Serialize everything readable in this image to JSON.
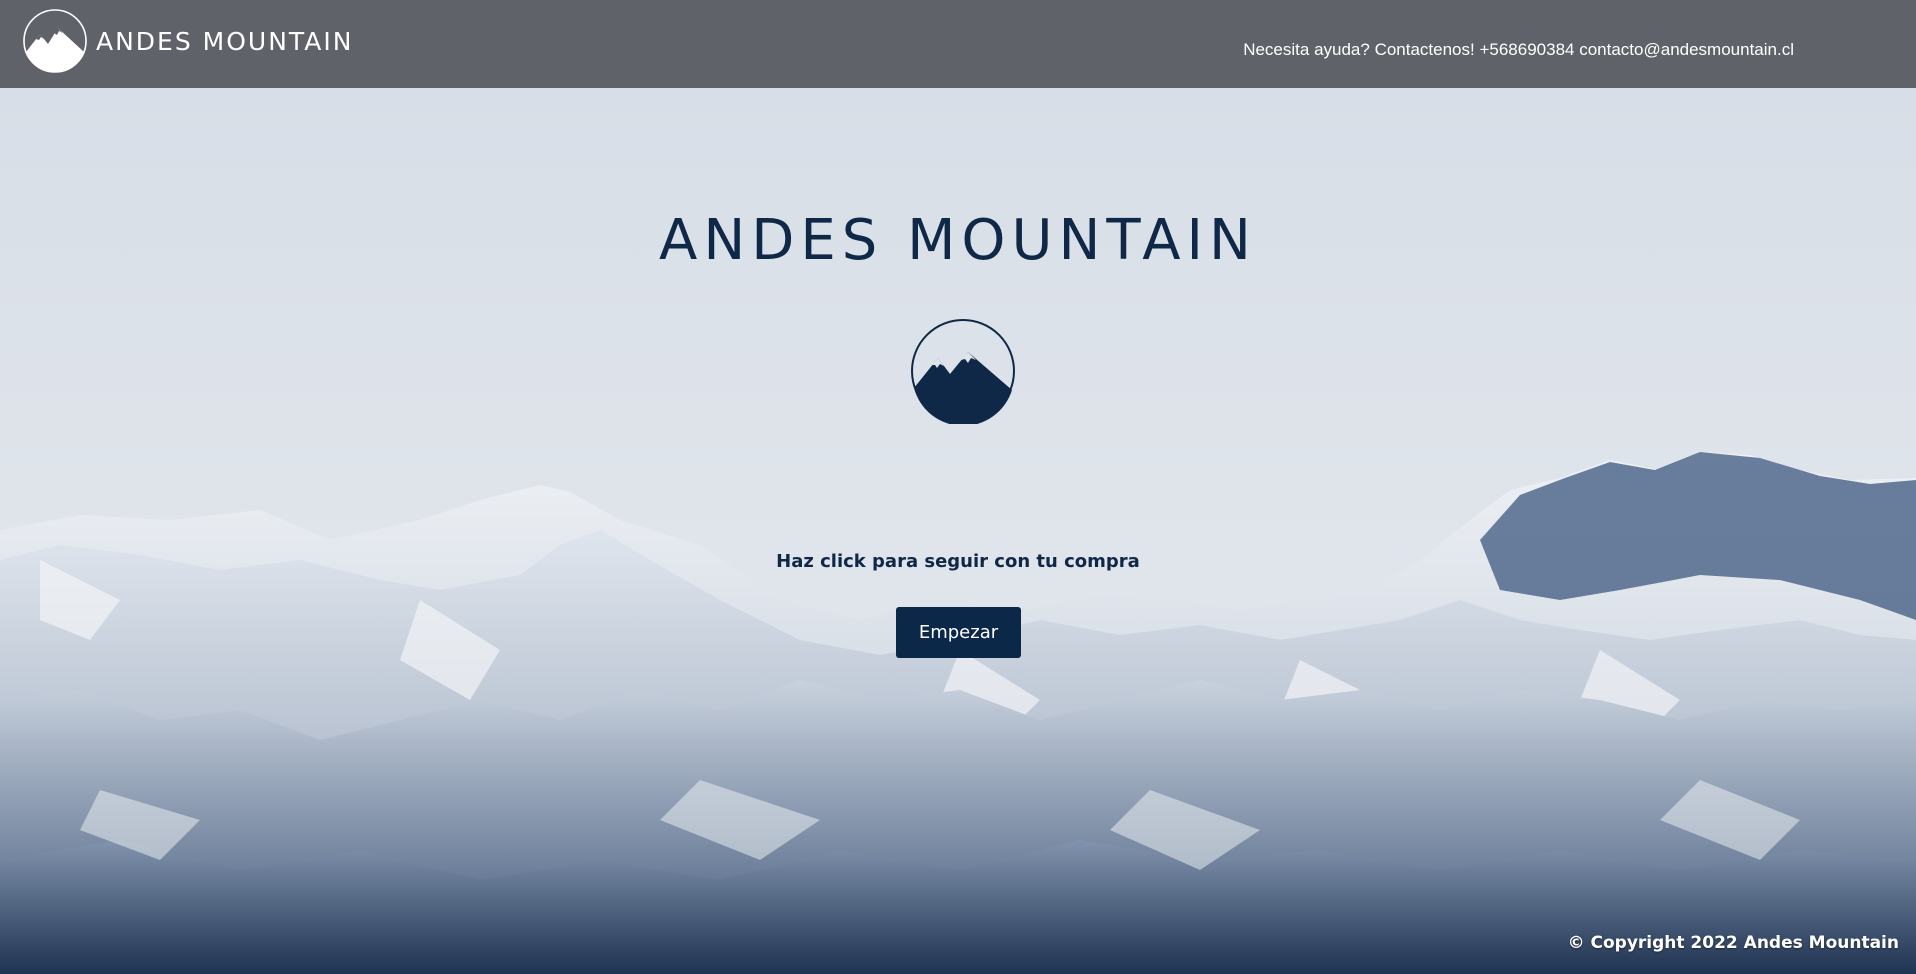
{
  "header": {
    "brand_name": "ANDES MOUNTAIN",
    "help_text": "Necesita ayuda? Contactenos! +568690384",
    "email": "contacto@andesmountain.cl",
    "logo_icon": "mountain-circle-logo-icon"
  },
  "hero": {
    "title": "ANDES MOUNTAIN",
    "logo_icon": "mountain-circle-logo-icon",
    "subtitle": "Haz click para seguir con tu compra",
    "button_label": "Empezar"
  },
  "footer": {
    "copyright": "© Copyright 2022 Andes Mountain"
  },
  "colors": {
    "header_bg": "#5f6268",
    "primary_navy": "#0c2848",
    "header_text": "#ffffff"
  }
}
